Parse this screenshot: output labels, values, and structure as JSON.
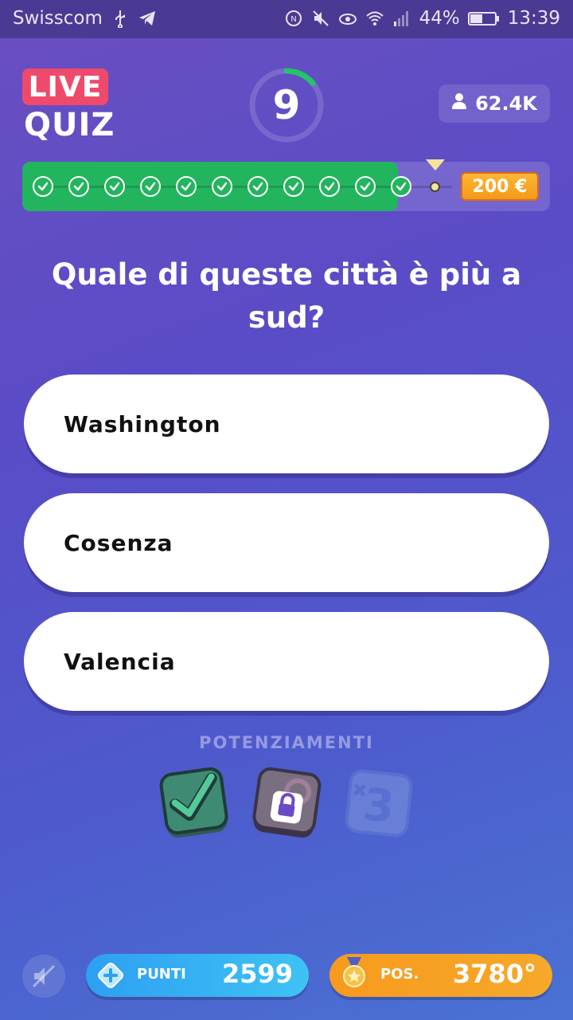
{
  "status_bar": {
    "carrier": "Swisscom",
    "battery": "44%",
    "time": "13:39",
    "icons": [
      "usb-icon",
      "telegram-icon",
      "nfc-icon",
      "mute-icon",
      "eye-icon",
      "wifi-icon",
      "signal-icon",
      "battery-icon"
    ]
  },
  "header": {
    "logo_top": "LIVE",
    "logo_bottom": "QUIZ",
    "timer": "9",
    "timer_progress": 0.14,
    "viewers": "62.4K"
  },
  "progress": {
    "completed": 11,
    "prize": "200 €"
  },
  "question": "Quale di queste città è più a sud?",
  "answers": [
    {
      "label": "Washington"
    },
    {
      "label": "Cosenza"
    },
    {
      "label": "Valencia"
    }
  ],
  "powerups": {
    "title": "POTENZIAMENTI",
    "items": [
      "check-answer-icon",
      "lock-icon",
      "plus-3-icon"
    ]
  },
  "footer": {
    "points_label": "PUNTI",
    "points_value": "2599",
    "position_label": "POS.",
    "position_value": "3780°"
  },
  "colors": {
    "accent_green": "#23b45e",
    "prize_orange": "#f29a17",
    "live_red": "#ef4a6b",
    "points_blue": "#2e9ff2",
    "position_orange": "#f79a1e"
  }
}
